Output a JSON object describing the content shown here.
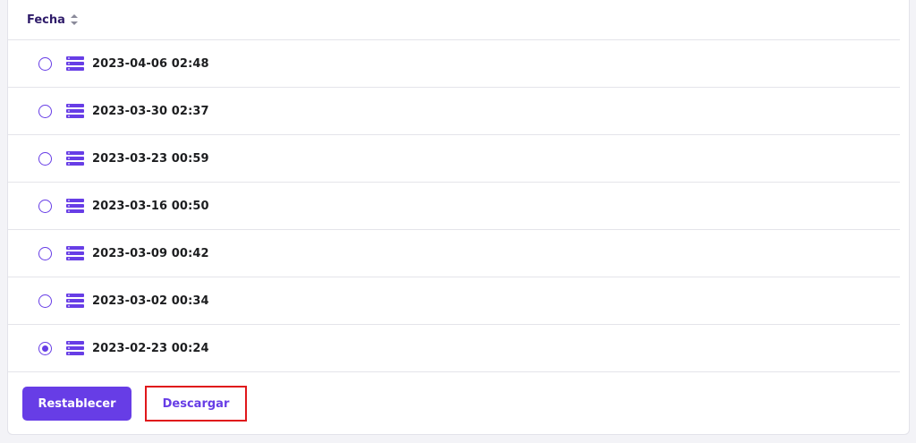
{
  "table": {
    "column_header": "Fecha"
  },
  "backups": [
    {
      "label": "2023-04-06 02:48",
      "selected": false
    },
    {
      "label": "2023-03-30 02:37",
      "selected": false
    },
    {
      "label": "2023-03-23 00:59",
      "selected": false
    },
    {
      "label": "2023-03-16 00:50",
      "selected": false
    },
    {
      "label": "2023-03-09 00:42",
      "selected": false
    },
    {
      "label": "2023-03-02 00:34",
      "selected": false
    },
    {
      "label": "2023-02-23 00:24",
      "selected": true
    }
  ],
  "footer": {
    "restore_label": "Restablecer",
    "download_label": "Descargar"
  },
  "icons": {
    "sort": "sort-icon",
    "row": "database-icon"
  },
  "colors": {
    "accent": "#673de6",
    "highlight": "#e0171b"
  }
}
